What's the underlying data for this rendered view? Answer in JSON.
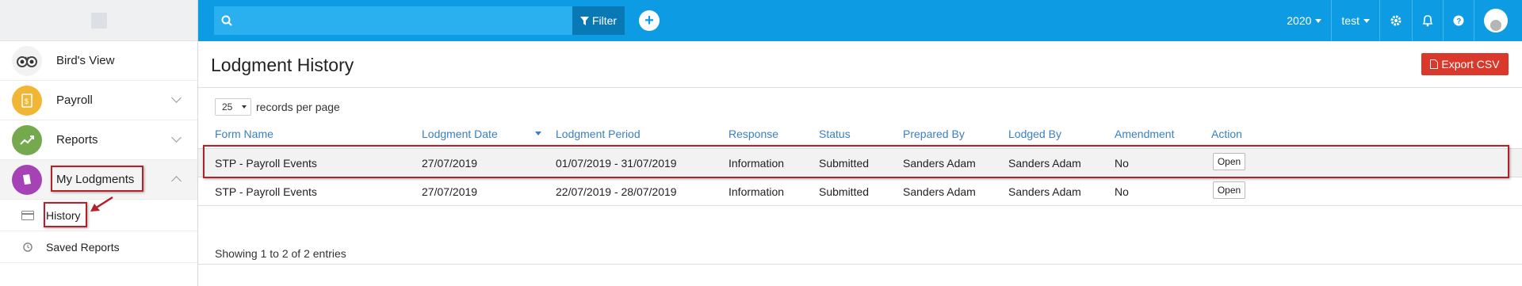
{
  "sidebar": {
    "items": [
      {
        "label": "Bird's View",
        "icon": "owl-icon",
        "color": "#f2f2f2"
      },
      {
        "label": "Payroll",
        "icon": "document-icon",
        "color": "#f1b734"
      },
      {
        "label": "Reports",
        "icon": "chart-icon",
        "color": "#74a94e"
      },
      {
        "label": "My Lodgments",
        "icon": "book-icon",
        "color": "#a442b6"
      }
    ],
    "subitems": [
      {
        "label": "History",
        "icon": "card-icon"
      },
      {
        "label": "Saved Reports",
        "icon": "clock-icon"
      }
    ]
  },
  "topbar": {
    "search_placeholder": "",
    "filter_label": "Filter",
    "year": "2020",
    "user": "test",
    "bg_color": "#0d9be3"
  },
  "page": {
    "title": "Lodgment History",
    "export_label": "Export CSV"
  },
  "table": {
    "page_size": "25",
    "rpp_label": "records per page",
    "columns": [
      "Form Name",
      "Lodgment Date",
      "Lodgment Period",
      "Response",
      "Status",
      "Prepared By",
      "Lodged By",
      "Amendment",
      "Action"
    ],
    "rows": [
      {
        "form": "STP - Payroll Events",
        "date": "27/07/2019",
        "period": "01/07/2019 - 31/07/2019",
        "response": "Information",
        "status": "Submitted",
        "prepared": "Sanders Adam",
        "lodged": "Sanders Adam",
        "amendment": "No",
        "action": "Open"
      },
      {
        "form": "STP - Payroll Events",
        "date": "27/07/2019",
        "period": "22/07/2019 - 28/07/2019",
        "response": "Information",
        "status": "Submitted",
        "prepared": "Sanders Adam",
        "lodged": "Sanders Adam",
        "amendment": "No",
        "action": "Open"
      }
    ],
    "footer": "Showing 1 to 2 of 2 entries"
  },
  "highlight_color": "#b5202a"
}
